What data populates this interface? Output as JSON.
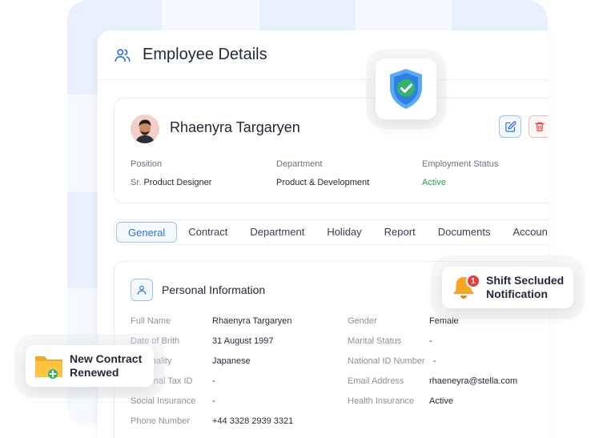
{
  "header": {
    "title": "Employee Details",
    "icon": "users-icon"
  },
  "employee": {
    "name": "Rhaenyra Targaryen",
    "position_label": "Position",
    "position_prefix": "Sr.",
    "position_value": "Product Designer",
    "department_label": "Department",
    "department_value": "Product & Development",
    "status_label": "Employment Status",
    "status_value": "Active",
    "status_color": "#22a55b"
  },
  "tabs": [
    "General",
    "Contract",
    "Department",
    "Holiday",
    "Report",
    "Documents",
    "Account"
  ],
  "active_tab": "General",
  "personal": {
    "title": "Personal Information",
    "left": [
      {
        "label": "Full Name",
        "value": "Rhaenyra Targaryen"
      },
      {
        "label": "Date of Brith",
        "value": "31 August 1997"
      },
      {
        "label": "Nationality",
        "value": "Japanese"
      },
      {
        "label": "Personal Tax ID",
        "value": "-"
      },
      {
        "label": "Social Insurance",
        "value": "-"
      },
      {
        "label": "Phone Number",
        "value": "+44 3328 2939 3321"
      }
    ],
    "right": [
      {
        "label": "Gender",
        "value": "Female"
      },
      {
        "label": "Marital Status",
        "value": "-"
      },
      {
        "label": "National ID Number",
        "value": "-"
      },
      {
        "label": "Email Address",
        "value": "rhaeneyra@stella.com"
      },
      {
        "label": "Health Insurance",
        "value": "Active"
      }
    ]
  },
  "notification": {
    "text": "Shift Secluded Notification",
    "line1": "Shift Secluded",
    "line2": "Notification",
    "count": "1"
  },
  "contract": {
    "line1": "New Contract",
    "line2": "Renewed"
  },
  "colors": {
    "accent": "#2f74d8",
    "danger": "#e53e3e",
    "success": "#22a55b"
  }
}
